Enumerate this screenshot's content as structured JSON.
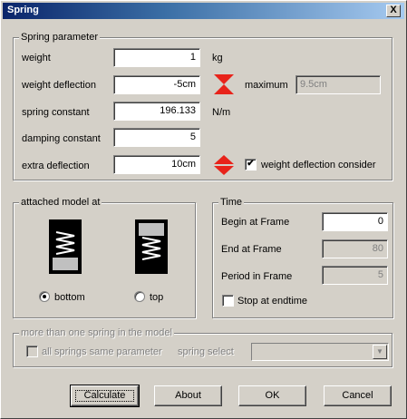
{
  "window": {
    "title": "Spring",
    "close_glyph": "X"
  },
  "spring_parameter": {
    "legend": "Spring parameter",
    "weight": {
      "label": "weight",
      "value": "1",
      "unit": "kg"
    },
    "weight_deflection": {
      "label": "weight deflection",
      "value": "-5cm",
      "maximum_label": "maximum",
      "maximum_value": "9.5cm"
    },
    "spring_constant": {
      "label": "spring constant",
      "value": "196.133",
      "unit": "N/m"
    },
    "damping_constant": {
      "label": "damping constant",
      "value": "5"
    },
    "extra_deflection": {
      "label": "extra deflection",
      "value": "10cm"
    },
    "weight_deflection_consider": {
      "label": "weight deflection consider",
      "checked": true,
      "check_glyph": "✔"
    }
  },
  "attached_model": {
    "legend": "attached model at",
    "bottom": {
      "label": "bottom",
      "selected": true
    },
    "top": {
      "label": "top",
      "selected": false
    }
  },
  "time": {
    "legend": "Time",
    "begin": {
      "label": "Begin at Frame",
      "value": "0"
    },
    "end": {
      "label": "End at Frame",
      "value": "80"
    },
    "period": {
      "label": "Period in Frame",
      "value": "5"
    },
    "stop_at_endtime": {
      "label": "Stop at endtime",
      "checked": false
    }
  },
  "multi_spring": {
    "legend": "more than one spring in the model",
    "all_same": {
      "label": "all springs same parameter",
      "checked": false
    },
    "spring_select": {
      "label": "spring select",
      "value": ""
    },
    "dropdown_glyph": "▼"
  },
  "buttons": {
    "calculate": "Calculate",
    "about": "About",
    "ok": "OK",
    "cancel": "Cancel"
  },
  "colors": {
    "spinner_red": "#e8231a",
    "title_bar_start": "#0a246a",
    "title_bar_end": "#a6caf0"
  },
  "icons": [
    "close-icon",
    "hourglass-spinner-icon",
    "double-arrow-spinner-icon",
    "spring-bottom-icon",
    "spring-top-icon",
    "dropdown-arrow-icon"
  ]
}
